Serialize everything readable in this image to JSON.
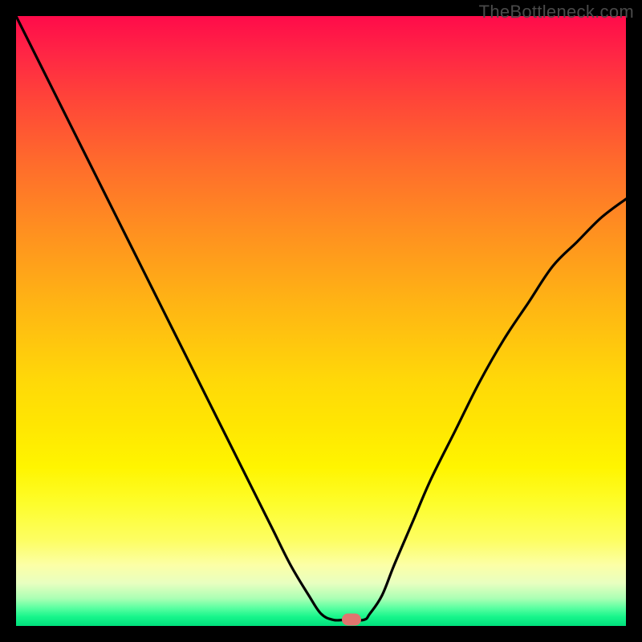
{
  "watermark": "TheBottleneck.com",
  "chart_data": {
    "type": "line",
    "title": "",
    "xlabel": "",
    "ylabel": "",
    "xlim": [
      0,
      100
    ],
    "ylim": [
      0,
      100
    ],
    "background_gradient": {
      "top_color": "#ff0b4a",
      "bottom_color": "#00e07c",
      "stops": [
        "red",
        "orange",
        "yellow",
        "light-yellow",
        "green"
      ]
    },
    "series": [
      {
        "name": "bottleneck-curve",
        "x": [
          0,
          3,
          6,
          9,
          12,
          15,
          18,
          21,
          24,
          27,
          30,
          33,
          36,
          39,
          42,
          45,
          48,
          50,
          52,
          54,
          57,
          58,
          60,
          62,
          65,
          68,
          72,
          76,
          80,
          84,
          88,
          92,
          96,
          100
        ],
        "y": [
          100,
          94,
          88,
          82,
          76,
          70,
          64,
          58,
          52,
          46,
          40,
          34,
          28,
          22,
          16,
          10,
          5,
          2,
          1,
          1,
          1,
          2,
          5,
          10,
          17,
          24,
          32,
          40,
          47,
          53,
          59,
          63,
          67,
          70
        ]
      }
    ],
    "marker": {
      "name": "optimal-point",
      "x": 55,
      "y": 1,
      "color": "#e0756f"
    }
  }
}
